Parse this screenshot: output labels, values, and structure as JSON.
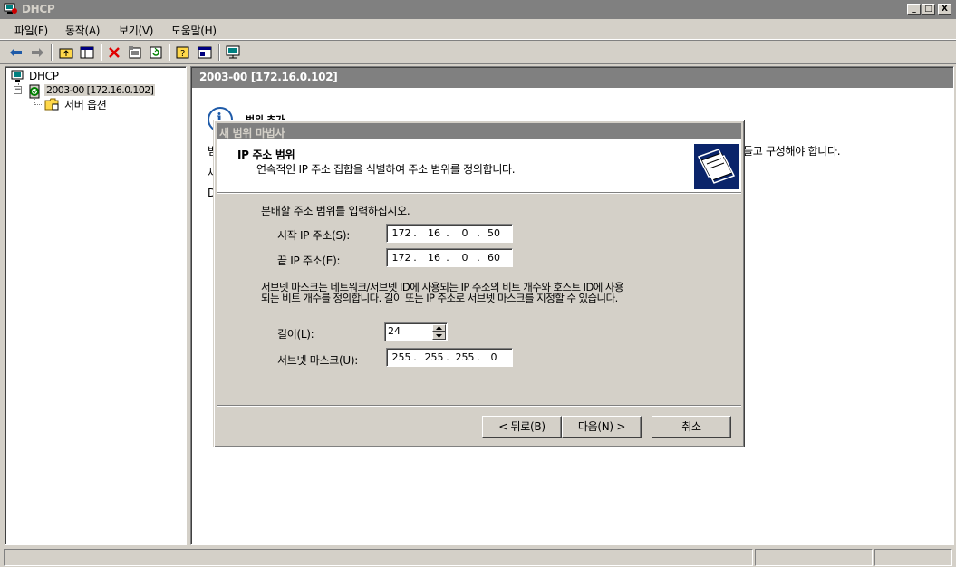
{
  "window": {
    "title": "DHCP",
    "minimize": "_",
    "maximize": "□",
    "close": "X"
  },
  "menu": [
    "파일(F)",
    "동작(A)",
    "보기(V)",
    "도움말(H)"
  ],
  "toolbar": {
    "icons": [
      "back-arrow-icon",
      "forward-arrow-icon",
      "up-folder-icon",
      "show-hide-tree-icon",
      "delete-icon",
      "properties-icon",
      "refresh-icon",
      "help-icon",
      "export-list-icon",
      "console-icon"
    ]
  },
  "tree": {
    "root": "DHCP",
    "server": "2003-00 [172.16.0.102]",
    "server_options": "서버 옵션"
  },
  "right_pane": {
    "header": "2003-00 [172.16.0.102]",
    "bg_heading": "범위 추가",
    "bg_line1_prefix": "범",
    "bg_line1_suffix": "들고 구성해야 합니다.",
    "bg_line2_prefix": "새",
    "bg_line3_prefix": "D"
  },
  "dialog": {
    "title": "새 범위 마법사",
    "header_title": "IP 주소 범위",
    "header_desc": "연속적인 IP 주소 집합을 식별하여 주소 범위를 정의합니다.",
    "instruction": "분배할 주소 범위를 입력하십시오.",
    "start_label": "시작 IP 주소(S):",
    "start_ip": [
      "172",
      "16",
      "0",
      "50"
    ],
    "end_label": "끝 IP 주소(E):",
    "end_ip": [
      "172",
      "16",
      "0",
      "60"
    ],
    "subnet_desc_1": "서브넷 마스크는 네트워크/서브넷 ID에 사용되는 IP 주소의 비트 개수와 호스트 ID에 사용",
    "subnet_desc_2": "되는 비트 개수를 정의합니다. 길이 또는 IP 주소로 서브넷 마스크를 지정할 수 있습니다.",
    "length_label": "길이(L):",
    "length_value": "24",
    "mask_label": "서브넷 마스크(U):",
    "mask_ip": [
      "255",
      "255",
      "255",
      "0"
    ],
    "back_button": "< 뒤로(B)",
    "next_button": "다음(N) >",
    "cancel_button": "취소"
  },
  "colors": {
    "titlebar": "#808080",
    "face": "#d4d0c8",
    "header_bg": "#808080"
  }
}
